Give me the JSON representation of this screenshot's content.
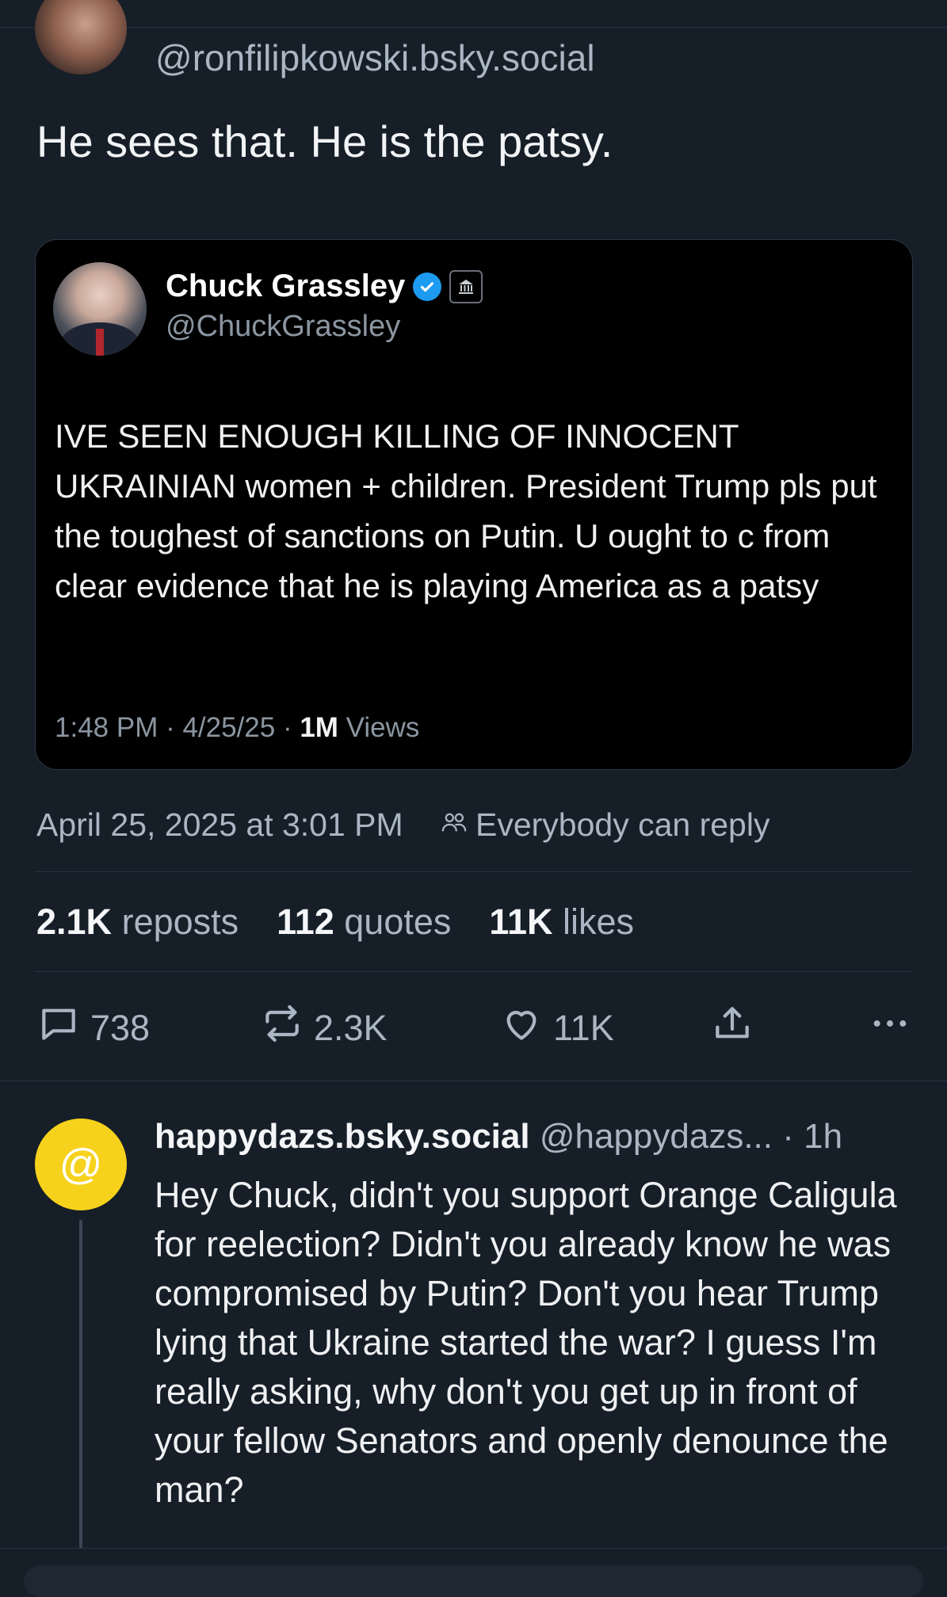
{
  "post": {
    "author_handle": "@ronfilipkowski.bsky.social",
    "text": "He sees that. He is the patsy.",
    "date": "April 25, 2025 at 3:01 PM",
    "reply_permission": "Everybody can reply"
  },
  "embed": {
    "name": "Chuck Grassley",
    "handle": "@ChuckGrassley",
    "body": "IVE SEEN ENOUGH KILLING OF INNOCENT UKRAINIAN women + children. President Trump pls put the toughest of sanctions on Putin. U ought to c from clear evidence that he is playing America as a patsy",
    "meta_time": "1:48 PM · 4/25/25 · ",
    "meta_views_count": "1M",
    "meta_views_label": " Views"
  },
  "stats": {
    "reposts_count": "2.1K",
    "reposts_label": "reposts",
    "quotes_count": "112",
    "quotes_label": "quotes",
    "likes_count": "11K",
    "likes_label": "likes"
  },
  "actions": {
    "replies": "738",
    "reposts": "2.3K",
    "likes": "11K"
  },
  "reply": {
    "name": "happydazs.bsky.social",
    "handle": "@happydazs...",
    "time": "· 1h",
    "avatar_glyph": "@",
    "body": "Hey Chuck, didn't you support Orange Caligula for reelection? Didn't you already know he was compromised by Putin? Don't you hear Trump lying that Ukraine started the war? I guess I'm  really asking, why don't you get up in front of your fellow Senators and openly denounce the man?"
  },
  "colors": {
    "background": "#161e27",
    "muted_text": "#aab6c3",
    "verified_blue": "#1d9bf0",
    "reply_avatar": "#f7d21d"
  }
}
